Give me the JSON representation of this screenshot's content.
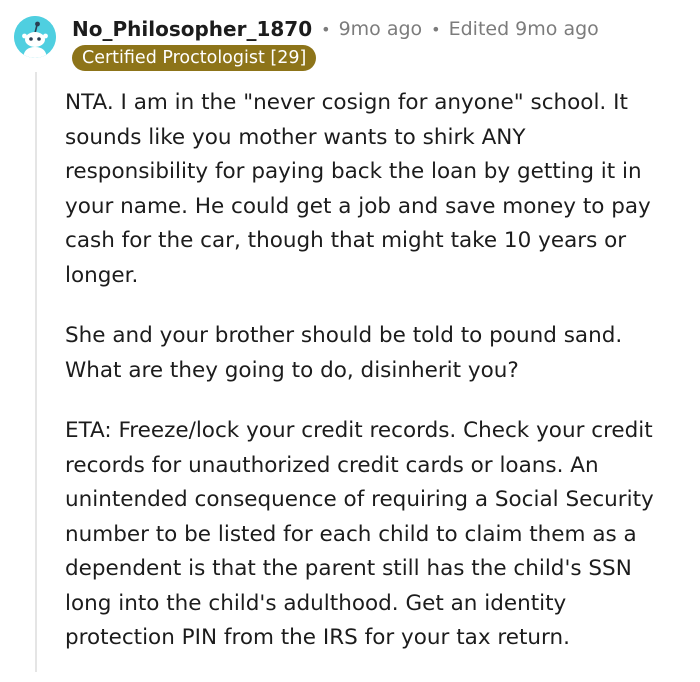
{
  "comment": {
    "username": "No_Philosopher_1870",
    "separator": "•",
    "time": "9mo ago",
    "edited": "Edited 9mo ago",
    "flair": "Certified Proctologist [29]",
    "paragraphs": [
      [
        "NTA. I am in the \"never cosign for anyone\" school. It",
        "sounds like you mother wants to shirk ANY",
        "responsibility for paying back the loan by getting it in",
        "your name. He could get a job and save money to pay",
        "cash for the car, though that might take 10 years or",
        "longer."
      ],
      [
        "She and your brother should be told to pound sand.",
        "What are they going to do, disinherit you?"
      ],
      [
        "ETA: Freeze/lock your credit records. Check your credit",
        "records for unauthorized credit cards or loans. An",
        "unintended consequence of requiring a Social Security",
        "number to be listed for each child to claim them as a",
        "dependent is that the parent still has the child's SSN",
        "long into the child's adulthood. Get an identity",
        "protection PIN from the IRS for your tax return."
      ]
    ]
  },
  "colors": {
    "avatar_bg": "#4fcfe0",
    "flair_bg": "#8d7419",
    "meta_text": "#7c7c7c",
    "body_text": "#1c1c1c"
  },
  "icons": {
    "avatar": "snoo-avatar-icon"
  }
}
